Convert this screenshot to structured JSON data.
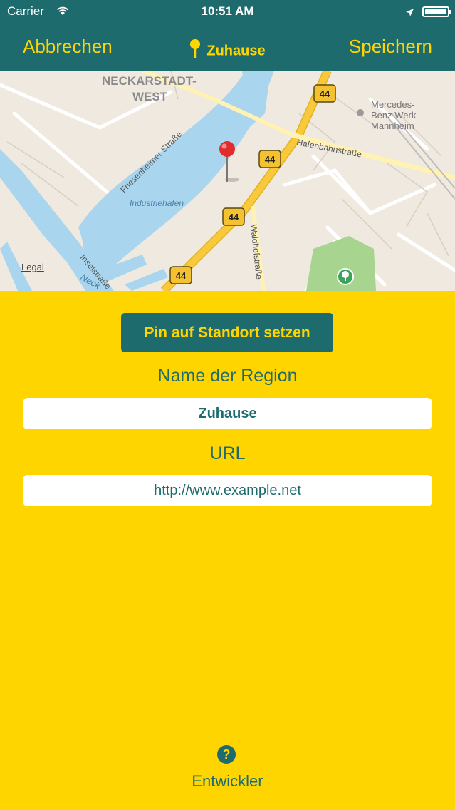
{
  "status_bar": {
    "carrier": "Carrier",
    "time": "10:51 AM"
  },
  "nav": {
    "cancel_label": "Abbrechen",
    "title": "Zuhause",
    "save_label": "Speichern"
  },
  "map": {
    "labels": {
      "district": "NECKARSTADT-",
      "district2": "WEST",
      "street1": "Friesenheimer Straße",
      "harbor": "Industriehafen",
      "street2": "Hafenbahnstraße",
      "poi1": "Mercedes-",
      "poi2": "Benz Werk",
      "poi3": "Mannheim",
      "street3": "Waldhofstraße",
      "street4": "Inselstraße",
      "river": "Neck",
      "legal": "Legal"
    },
    "route_number": "44"
  },
  "form": {
    "pin_button_label": "Pin auf Standort setzen",
    "region_label": "Name der Region",
    "region_value": "Zuhause",
    "url_label": "URL",
    "url_value": "http://www.example.net"
  },
  "footer": {
    "help_glyph": "?",
    "developer_label": "Entwickler"
  },
  "colors": {
    "primary": "#1E6B6E",
    "accent": "#FFD500",
    "water": "#A9D6EE",
    "park": "#A7D58F",
    "road": "#F9C93A"
  }
}
